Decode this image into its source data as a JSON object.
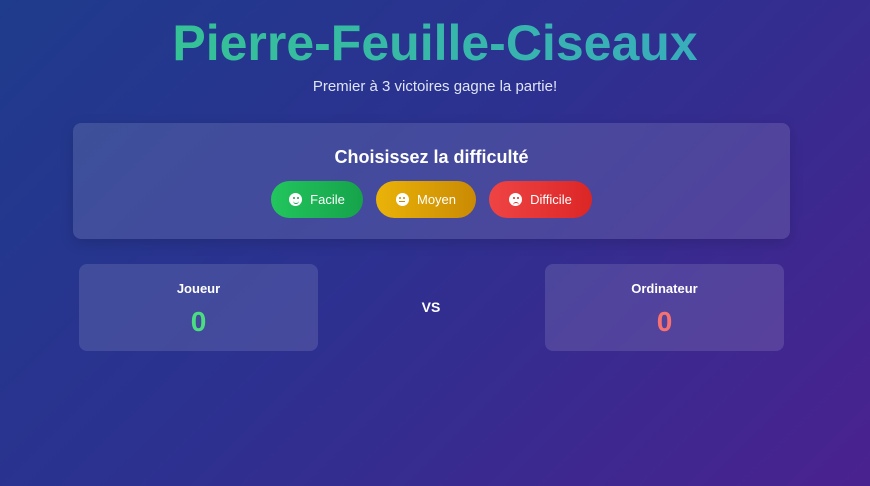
{
  "header": {
    "title": "Pierre-Feuille-Ciseaux",
    "subtitle": "Premier à 3 victoires gagne la partie!"
  },
  "difficulty": {
    "title": "Choisissez la difficulté",
    "buttons": [
      {
        "label": "Facile",
        "icon": "smile-icon",
        "color": "#22c55e"
      },
      {
        "label": "Moyen",
        "icon": "neutral-face-icon",
        "color": "#eab308"
      },
      {
        "label": "Difficile",
        "icon": "frown-icon",
        "color": "#ef4444"
      }
    ]
  },
  "scoreboard": {
    "player": {
      "label": "Joueur",
      "score": "0",
      "color": "#4ade80"
    },
    "vs": "VS",
    "computer": {
      "label": "Ordinateur",
      "score": "0",
      "color": "#f87171"
    }
  }
}
